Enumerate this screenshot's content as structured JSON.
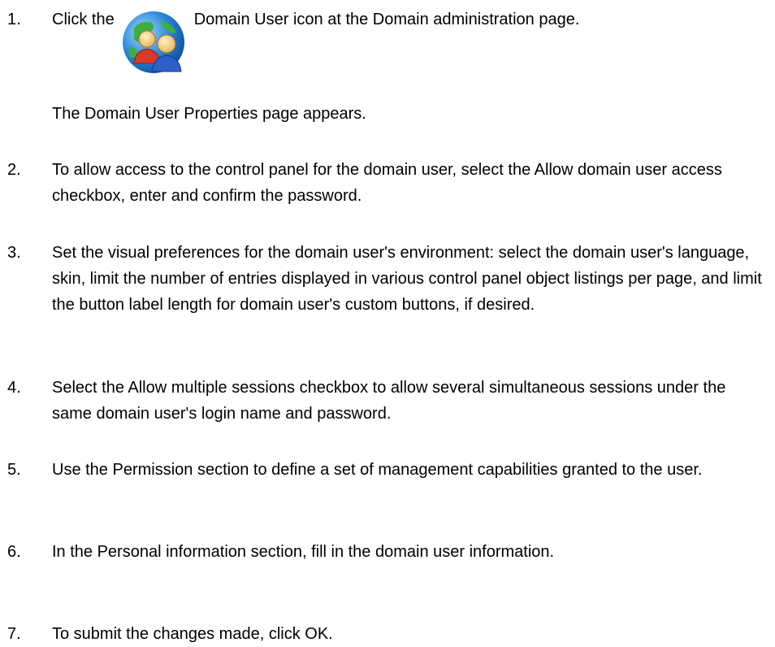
{
  "steps": [
    {
      "number": "1.",
      "text_before_icon": "Click the",
      "text_after_icon": "Domain User icon at the Domain administration page.",
      "icon": "domain-user-icon",
      "result": "The Domain User Properties page appears."
    },
    {
      "number": "2.",
      "text": "To allow access to the control panel for the domain user, select the Allow domain user access checkbox, enter and confirm the password."
    },
    {
      "number": "3.",
      "text": "Set the visual preferences for the domain user's environment: select the domain user's language, skin, limit the number of entries displayed in various control panel object listings per page, and limit the button label length for domain user's custom buttons, if desired."
    },
    {
      "number": "4.",
      "text": "Select the Allow multiple sessions checkbox to allow several simultaneous sessions under the same domain user's login name and password."
    },
    {
      "number": "5.",
      "text": "Use the Permission section to define a set of management capabilities granted to the user."
    },
    {
      "number": "6.",
      "text": "In the Personal information section, fill in the domain user information."
    },
    {
      "number": "7.",
      "text": "To submit the changes made, click OK."
    }
  ]
}
